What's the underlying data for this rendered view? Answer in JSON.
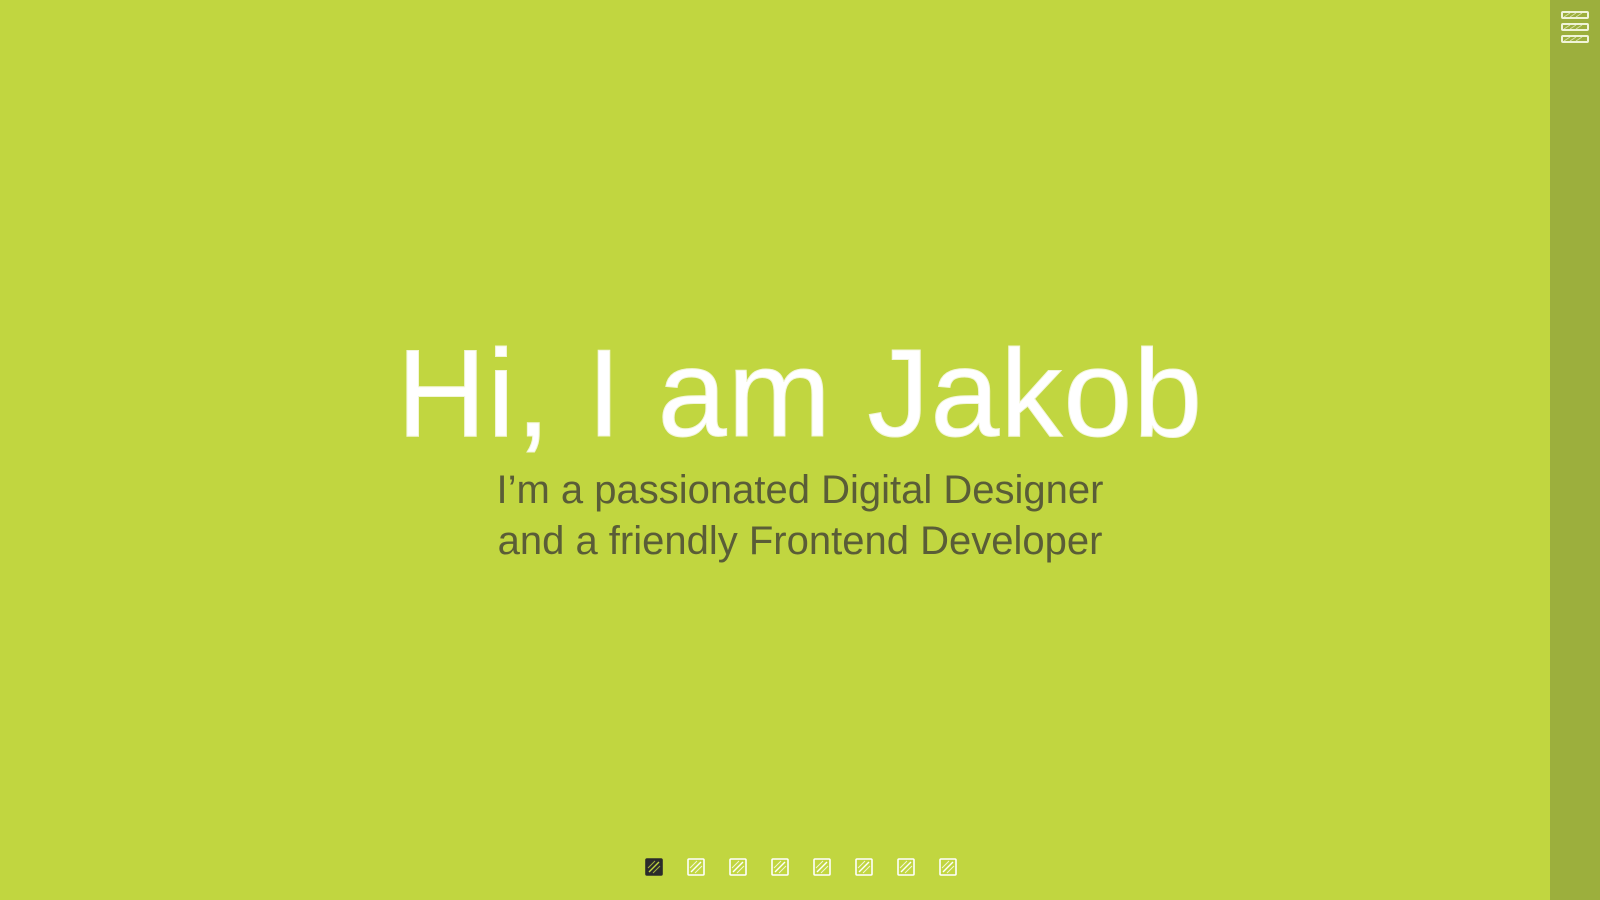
{
  "hero": {
    "title": "Hi, I am Jakob",
    "subtitle_line1": "I’m a passionated Digital Designer",
    "subtitle_line2": "and a friendly Frontend Developer"
  },
  "menu": {
    "icon": "hamburger-menu-icon"
  },
  "pagination": {
    "count": 8,
    "active_index": 0,
    "icon": "sketch-square-icon"
  },
  "colors": {
    "background": "#c1d640",
    "side_strip": "#9caf3d",
    "title": "#ffffff",
    "subtitle": "#5a5d37",
    "dot_active": "#2b2b2b",
    "dot_inactive": "#ffffff"
  }
}
